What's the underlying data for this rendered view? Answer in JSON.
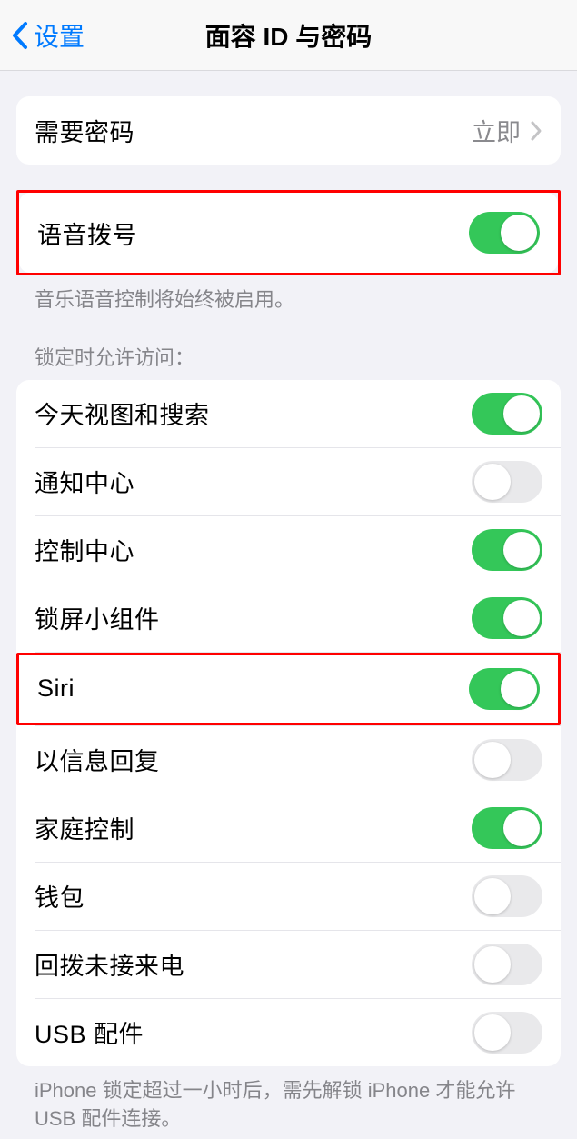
{
  "navbar": {
    "back_label": "设置",
    "title": "面容 ID 与密码"
  },
  "require_passcode": {
    "label": "需要密码",
    "value": "立即"
  },
  "voice_dial": {
    "label": "语音拨号",
    "footer": "音乐语音控制将始终被启用。"
  },
  "lock_access": {
    "header": "锁定时允许访问：",
    "items": [
      {
        "label": "今天视图和搜索",
        "on": true
      },
      {
        "label": "通知中心",
        "on": false
      },
      {
        "label": "控制中心",
        "on": true
      },
      {
        "label": "锁屏小组件",
        "on": true
      },
      {
        "label": "Siri",
        "on": true,
        "highlight": true
      },
      {
        "label": "以信息回复",
        "on": false
      },
      {
        "label": "家庭控制",
        "on": true
      },
      {
        "label": "钱包",
        "on": false
      },
      {
        "label": "回拨未接来电",
        "on": false
      },
      {
        "label": "USB 配件",
        "on": false
      }
    ],
    "footer": "iPhone 锁定超过一小时后，需先解锁 iPhone 才能允许USB 配件连接。"
  }
}
